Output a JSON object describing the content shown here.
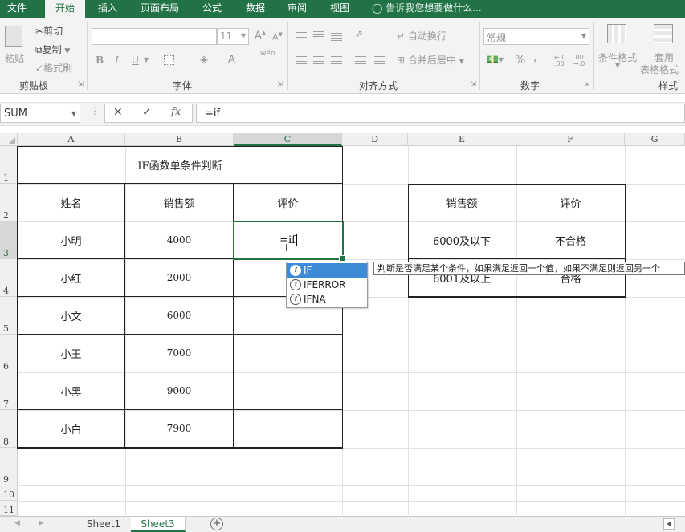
{
  "menu": {
    "tabs": [
      "文件",
      "开始",
      "插入",
      "页面布局",
      "公式",
      "数据",
      "审阅",
      "视图"
    ],
    "active": "开始",
    "tell_me": "告诉我您想要做什么..."
  },
  "ribbon": {
    "clipboard": {
      "paste": "粘贴",
      "cut": "剪切",
      "copy": "复制",
      "format_painter": "格式刷",
      "group": "剪贴板"
    },
    "font": {
      "size": "11",
      "group": "字体",
      "bold": "B",
      "italic": "I",
      "underline": "U",
      "font_color": "A",
      "phonetic": "wén"
    },
    "alignment": {
      "wrap_text": "自动换行",
      "merge_center": "合并后居中",
      "group": "对齐方式"
    },
    "number": {
      "format": "常规",
      "percent": "%",
      "comma": ",",
      "group": "数字"
    },
    "styles": {
      "conditional": "条件格式",
      "table_format_1": "套用",
      "table_format_2": "表格格式",
      "group": "样式"
    }
  },
  "formula_bar": {
    "name_box": "SUM",
    "fx": "fx",
    "formula": "=if"
  },
  "columns": [
    "A",
    "B",
    "C",
    "D",
    "E",
    "F",
    "G"
  ],
  "selected_column": "C",
  "rows": [
    "1",
    "2",
    "3",
    "4",
    "5",
    "6",
    "7",
    "8",
    "9",
    "10",
    "11"
  ],
  "selected_row": "3",
  "main_table": {
    "title": "IF函数单条件判断",
    "headers": [
      "姓名",
      "销售额",
      "评价"
    ],
    "rows": [
      [
        "小明",
        "4000",
        "=if"
      ],
      [
        "小红",
        "2000",
        ""
      ],
      [
        "小文",
        "6000",
        ""
      ],
      [
        "小王",
        "7000",
        ""
      ],
      [
        "小黑",
        "9000",
        ""
      ],
      [
        "小白",
        "7900",
        ""
      ]
    ]
  },
  "side_table": {
    "headers": [
      "销售额",
      "评价"
    ],
    "rows": [
      [
        "6000及以下",
        "不合格"
      ],
      [
        "6001及以上",
        "合格"
      ]
    ]
  },
  "autocomplete": {
    "items": [
      "IF",
      "IFERROR",
      "IFNA"
    ],
    "selected": "IF",
    "tooltip": "判断是否满足某个条件，如果满足返回一个值，如果不满足则返回另一个"
  },
  "sheets": {
    "tabs": [
      "Sheet1",
      "Sheet3"
    ],
    "active": "Sheet3"
  },
  "colors": {
    "accent": "#217346",
    "selection": "#3c8ad8"
  }
}
